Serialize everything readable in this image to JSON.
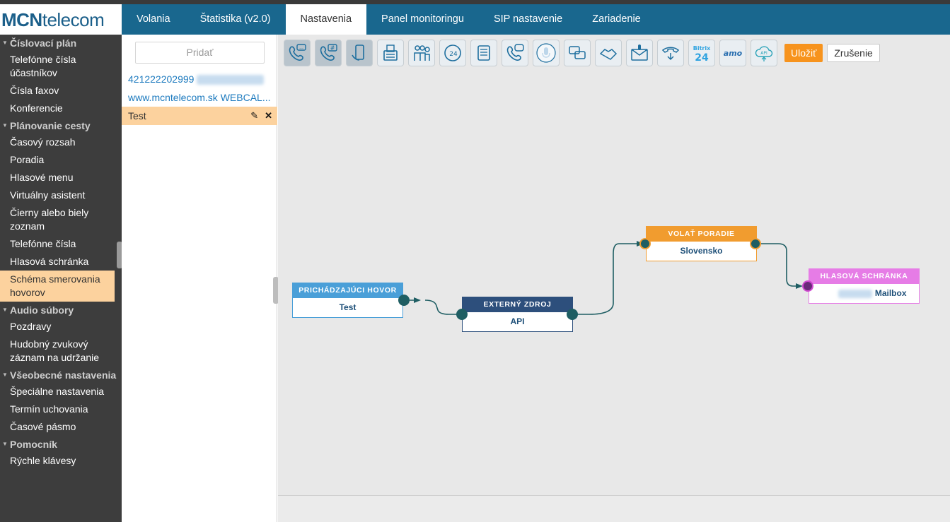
{
  "app": {
    "logo_bold": "MCN",
    "logo_rest": "telecom"
  },
  "nav": {
    "items": [
      "Volania",
      "Štatistika (v2.0)",
      "Nastavenia",
      "Panel monitoringu",
      "SIP nastavenie",
      "Zariadenie"
    ],
    "active": "Nastavenia"
  },
  "sidebar": {
    "sections": [
      {
        "title": "Číslovací plán",
        "items": [
          "Telefónne čísla účastníkov",
          "Čísla faxov",
          "Konferencie"
        ]
      },
      {
        "title": "Plánovanie cesty",
        "items": [
          "Časový rozsah",
          "Poradia",
          "Hlasové menu",
          "Virtuálny asistent",
          "Čierny alebo biely zoznam",
          "Telefónne čísla",
          "Hlasová schránka",
          "Schéma smerovania hovorov"
        ]
      },
      {
        "title": "Audio súbory",
        "items": [
          "Pozdravy",
          "Hudobný zvukový záznam na udržanie"
        ]
      },
      {
        "title": "Všeobecné nastavenia",
        "items": [
          "Špeciálne nastavenia",
          "Termín uchovania",
          "Časové pásmo"
        ]
      },
      {
        "title": "Pomocník",
        "items": [
          "Rýchle klávesy"
        ]
      }
    ],
    "active_item": "Schéma smerovania hovorov"
  },
  "list_panel": {
    "add_label": "Pridať",
    "items": [
      {
        "label": "421222202999",
        "active": false
      },
      {
        "label": "www.mcntelecom.sk WEBCAL...",
        "active": false
      },
      {
        "label": "Test",
        "active": true
      }
    ],
    "edit_icon": "pencil-icon",
    "delete_icon": "close-icon"
  },
  "toolbar": {
    "tools": [
      "call-message-icon",
      "call-hash-icon",
      "mobile-call-icon",
      "fax-icon",
      "queue-people-icon",
      "clock-24-icon",
      "scroll-doc-icon",
      "call-speech-icon",
      "microphone-icon",
      "chat-bubbles-icon",
      "handshake-icon",
      "mail-voice-icon",
      "phone-download-icon",
      "bitrix24-icon",
      "amo-icon",
      "api-cloud-icon"
    ],
    "bitrix_text": "Bitrix",
    "bitrix_num": "24",
    "amo_text": "amo",
    "api_text": "API",
    "save_label": "Uložiť",
    "cancel_label": "Zrušenie"
  },
  "flow": {
    "nodes": [
      {
        "id": "incoming",
        "title": "PRICHÁDZAJÚCI HOVOR",
        "value": "Test",
        "color": "#4a9fd8"
      },
      {
        "id": "external",
        "title": "EXTERNÝ ZDROJ",
        "value": "API",
        "color": "#2d4f7c"
      },
      {
        "id": "queue",
        "title": "VOLAŤ PORADIE",
        "value": "Slovensko",
        "color": "#f19c2f"
      },
      {
        "id": "voicemail",
        "title": "HLASOVÁ SCHRÁNKA",
        "value": "Mailbox",
        "color": "#e67ce6"
      }
    ]
  },
  "colors": {
    "topbar": "#19678e",
    "sidebar": "#3d3d3d",
    "highlight": "#fcd29e",
    "save": "#f7931d",
    "wire": "#1f5e63"
  }
}
